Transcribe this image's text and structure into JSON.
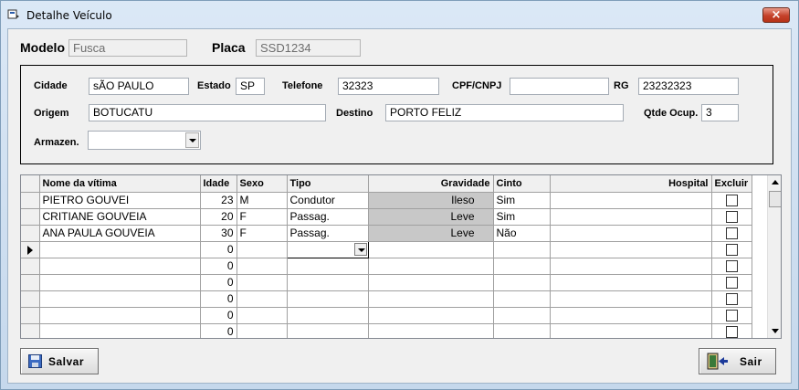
{
  "window": {
    "title": "Detalhe Veículo",
    "close_label": "×"
  },
  "vehicle": {
    "modelo_label": "Modelo",
    "modelo_value": "Fusca",
    "placa_label": "Placa",
    "placa_value": "SSD1234"
  },
  "form": {
    "cidade_label": "Cidade",
    "cidade_value": "sÃO PAULO",
    "estado_label": "Estado",
    "estado_value": "SP",
    "telefone_label": "Telefone",
    "telefone_value": "32323",
    "cpf_label": "CPF/CNPJ",
    "cpf_value": "",
    "rg_label": "RG",
    "rg_value": "23232323",
    "origem_label": "Origem",
    "origem_value": "BOTUCATU",
    "destino_label": "Destino",
    "destino_value": "PORTO FELIZ",
    "qtde_label": "Qtde Ocup.",
    "qtde_value": "3",
    "armazen_label": "Armazen.",
    "armazen_value": ""
  },
  "grid": {
    "columns": [
      "Nome da vítima",
      "Idade",
      "Sexo",
      "Tipo",
      "Gravidade",
      "Cinto",
      "Hospital",
      "Excluir"
    ],
    "rows": [
      {
        "nome": "PIETRO GOUVEI",
        "idade": "23",
        "sexo": "M",
        "tipo": "Condutor",
        "gravidade": "Ileso",
        "cinto": "Sim",
        "hospital": ""
      },
      {
        "nome": "CRITIANE GOUVEIA",
        "idade": "20",
        "sexo": "F",
        "tipo": "Passag.",
        "gravidade": "Leve",
        "cinto": "Sim",
        "hospital": ""
      },
      {
        "nome": "ANA PAULA GOUVEIA",
        "idade": "30",
        "sexo": "F",
        "tipo": "Passag.",
        "gravidade": "Leve",
        "cinto": "Não",
        "hospital": ""
      },
      {
        "nome": "",
        "idade": "0",
        "sexo": "",
        "tipo": "",
        "gravidade": "",
        "cinto": "",
        "hospital": ""
      },
      {
        "nome": "",
        "idade": "0",
        "sexo": "",
        "tipo": "",
        "gravidade": "",
        "cinto": "",
        "hospital": ""
      },
      {
        "nome": "",
        "idade": "0",
        "sexo": "",
        "tipo": "",
        "gravidade": "",
        "cinto": "",
        "hospital": ""
      },
      {
        "nome": "",
        "idade": "0",
        "sexo": "",
        "tipo": "",
        "gravidade": "",
        "cinto": "",
        "hospital": ""
      },
      {
        "nome": "",
        "idade": "0",
        "sexo": "",
        "tipo": "",
        "gravidade": "",
        "cinto": "",
        "hospital": ""
      },
      {
        "nome": "",
        "idade": "0",
        "sexo": "",
        "tipo": "",
        "gravidade": "",
        "cinto": "",
        "hospital": ""
      }
    ]
  },
  "buttons": {
    "salvar_label": "Salvar",
    "sair_label": "Sair"
  }
}
